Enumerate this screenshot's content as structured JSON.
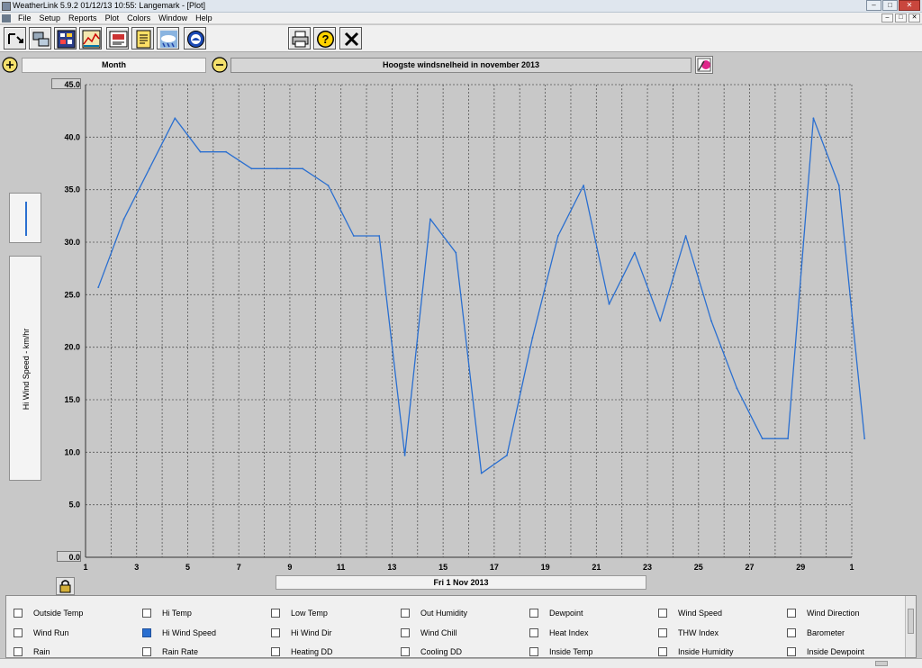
{
  "window": {
    "title": "WeatherLink 5.9.2  01/12/13  10:55: Langemark - [Plot]"
  },
  "menu": [
    "File",
    "Setup",
    "Reports",
    "Plot",
    "Colors",
    "Window",
    "Help"
  ],
  "toolbar": {
    "buttons": [
      "select-station-icon",
      "download-icon",
      "bulletin-icon",
      "plot-icon",
      "browse-icon",
      "notepad-icon",
      "weather-icon",
      "noaa-icon",
      "print-icon",
      "help-icon",
      "close-x-icon"
    ]
  },
  "controls": {
    "period": "Month",
    "plot_title": "Hoogste windsnelheid in november 2013",
    "date_label": "Fri 1 Nov 2013"
  },
  "chart_data": {
    "type": "line",
    "title": "Hoogste windsnelheid in november 2013",
    "ylabel": "Hi Wind Speed - km/hr",
    "xlabel": "Fri 1 Nov 2013",
    "ylim": [
      0,
      45
    ],
    "xlim": [
      1,
      31
    ],
    "yticks": [
      "0.0",
      "5.0",
      "10.0",
      "15.0",
      "20.0",
      "25.0",
      "30.0",
      "35.0",
      "40.0",
      "45.0"
    ],
    "xticks": [
      "1",
      "3",
      "5",
      "7",
      "9",
      "11",
      "13",
      "15",
      "17",
      "19",
      "21",
      "23",
      "25",
      "27",
      "29",
      "1"
    ],
    "grid": true,
    "series": [
      {
        "name": "Hi Wind Speed",
        "color": "#2a6fd0",
        "x": [
          1.5,
          2.5,
          3.5,
          4.5,
          5.5,
          6.5,
          7.5,
          8.5,
          9.5,
          10.5,
          11.5,
          12.5,
          13.5,
          14.5,
          15.5,
          16.5,
          17.5,
          18.5,
          19.5,
          20.5,
          21.5,
          22.5,
          23.5,
          24.5,
          25.5,
          26.5,
          27.5,
          28.5,
          29.5,
          30.5,
          31.5
        ],
        "values": [
          25.7,
          32.2,
          37.0,
          41.8,
          38.6,
          38.6,
          37.0,
          37.0,
          37.0,
          35.4,
          30.6,
          30.6,
          9.7,
          32.2,
          29.0,
          8.0,
          9.7,
          20.9,
          30.6,
          35.4,
          24.1,
          29.0,
          22.5,
          30.6,
          22.5,
          16.1,
          11.3,
          11.3,
          41.8,
          35.4,
          11.3
        ]
      }
    ]
  },
  "sensors": [
    {
      "label": "Outside Temp",
      "checked": false
    },
    {
      "label": "Hi Temp",
      "checked": false
    },
    {
      "label": "Low Temp",
      "checked": false
    },
    {
      "label": "Out Humidity",
      "checked": false
    },
    {
      "label": "Dewpoint",
      "checked": false
    },
    {
      "label": "Wind Speed",
      "checked": false
    },
    {
      "label": "Wind Direction",
      "checked": false
    },
    {
      "label": "Wind Run",
      "checked": false
    },
    {
      "label": "Hi Wind Speed",
      "checked": true
    },
    {
      "label": "Hi Wind Dir",
      "checked": false
    },
    {
      "label": "Wind Chill",
      "checked": false
    },
    {
      "label": "Heat Index",
      "checked": false
    },
    {
      "label": "THW Index",
      "checked": false
    },
    {
      "label": "Barometer",
      "checked": false
    },
    {
      "label": "Rain",
      "checked": false
    },
    {
      "label": "Rain Rate",
      "checked": false
    },
    {
      "label": "Heating DD",
      "checked": false
    },
    {
      "label": "Cooling DD",
      "checked": false
    },
    {
      "label": "Inside Temp",
      "checked": false
    },
    {
      "label": "Inside Humidity",
      "checked": false
    },
    {
      "label": "Inside Dewpoint",
      "checked": false
    }
  ]
}
